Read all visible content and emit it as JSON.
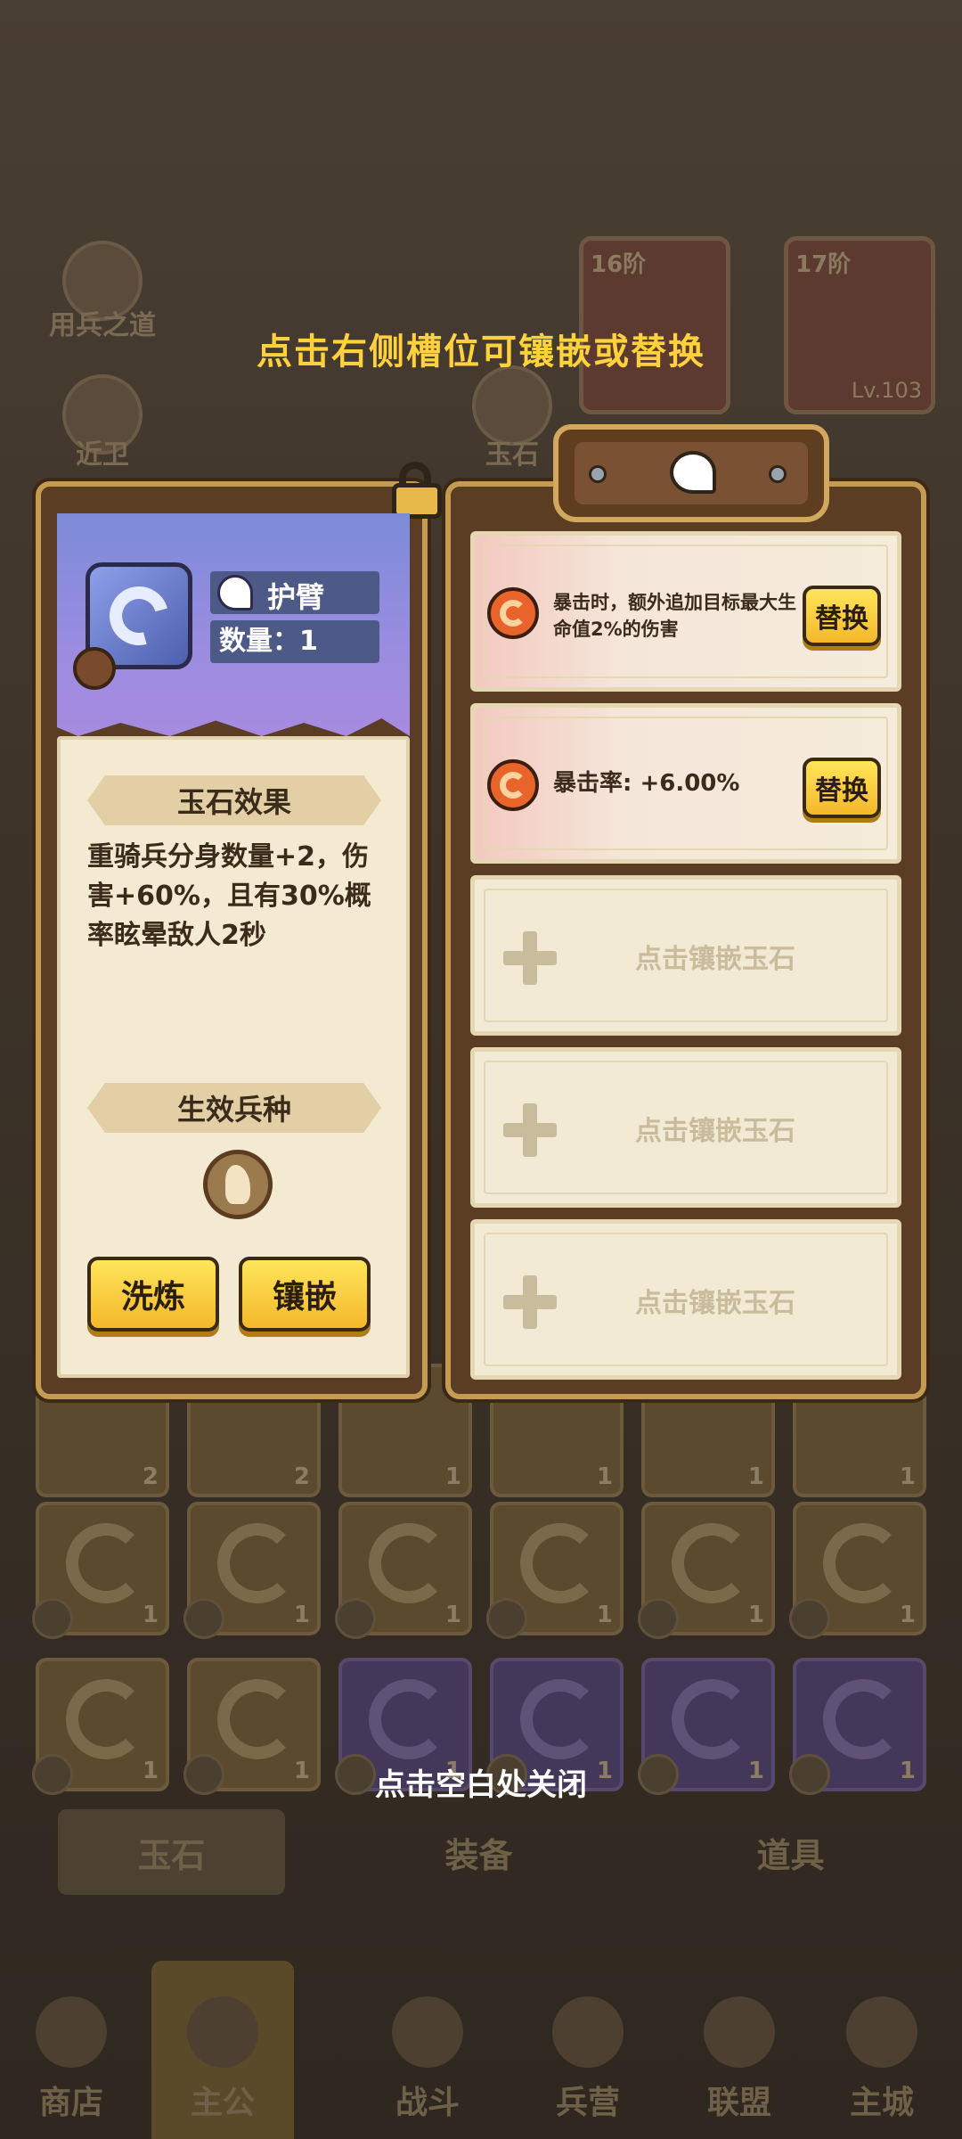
{
  "background": {
    "menu_items": [
      "用兵之道",
      "近卫",
      "玉石"
    ],
    "hero_cards": [
      {
        "tier": "16阶"
      },
      {
        "tier": "17阶",
        "level": "Lv.103"
      }
    ],
    "inventory_counts": [
      "2",
      "2",
      "1",
      "1",
      "1",
      "1",
      "1",
      "1",
      "1",
      "1",
      "1",
      "1",
      "1",
      "1",
      "1",
      "1",
      "1",
      "1"
    ],
    "inventory_tabs": [
      "玉石",
      "装备",
      "道具"
    ],
    "bottom_nav": [
      "商店",
      "主公",
      "战斗",
      "兵营",
      "联盟",
      "主城"
    ]
  },
  "overlay": {
    "top_hint": "点击右侧槽位可镶嵌或替换",
    "close_hint": "点击空白处关闭"
  },
  "gem_info": {
    "name": "护臂",
    "quantity": "数量：1",
    "effect_title": "玉石效果",
    "effect_text": "重骑兵分身数量+2，伤害+60%，且有30%概率眩晕敌人2秒",
    "troop_title": "生效兵种",
    "refine_button": "洗炼",
    "inlay_button": "镶嵌"
  },
  "slots": [
    {
      "text": "暴击时，额外追加目标最大生命值2%的伤害",
      "button": "替换"
    },
    {
      "text": "暴击率: +6.00%",
      "button": "替换"
    },
    {
      "text": "点击镶嵌玉石"
    },
    {
      "text": "点击镶嵌玉石"
    },
    {
      "text": "点击镶嵌玉石"
    }
  ],
  "colors": {
    "hint_yellow": "#ffd23d",
    "button_yellow": "#f4b82a",
    "panel_brown": "#5a3d22"
  }
}
